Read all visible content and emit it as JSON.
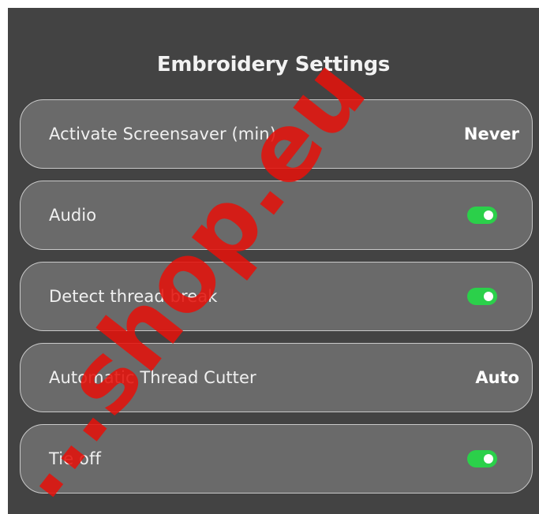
{
  "header": {
    "title": "Embroidery Settings"
  },
  "settings": [
    {
      "label": "Activate Screensaver (min)",
      "type": "value",
      "value": "Never"
    },
    {
      "label": "Audio",
      "type": "toggle",
      "state": "on"
    },
    {
      "label": "Detect thread break",
      "type": "toggle",
      "state": "on"
    },
    {
      "label": "Automatic Thread Cutter",
      "type": "value",
      "value": "Auto"
    },
    {
      "label": "Tie off",
      "type": "toggle",
      "state": "on"
    }
  ],
  "watermark": {
    "text": "...shop.eu",
    "color": "#e3120b"
  },
  "colors": {
    "panel": "#434343",
    "row": "#6a6a6a",
    "toggle_on": "#2bd04a"
  }
}
